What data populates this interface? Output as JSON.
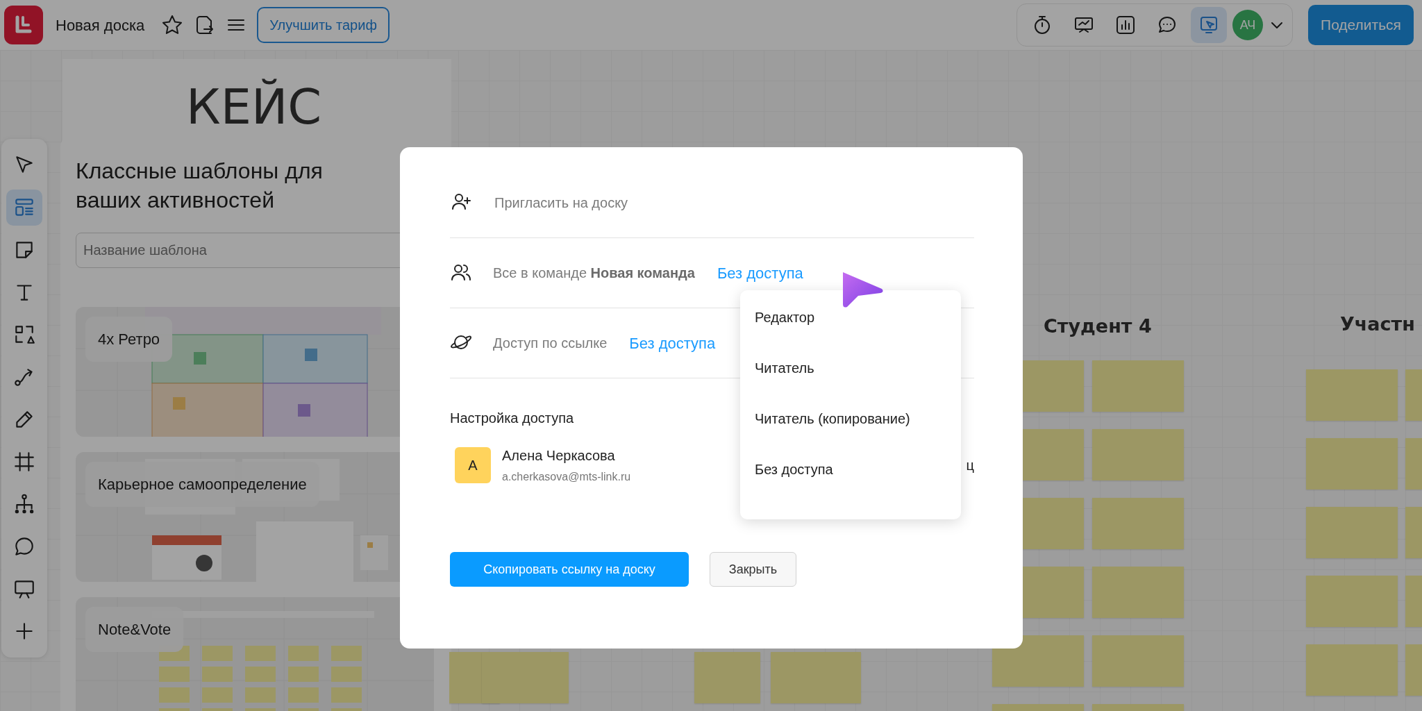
{
  "topbar": {
    "board_title": "Новая доска",
    "upgrade_button": "Улучшить тариф",
    "tools": [
      {
        "kind": "timer",
        "selected": false
      },
      {
        "kind": "presentation",
        "selected": false
      },
      {
        "kind": "chart",
        "selected": false
      },
      {
        "kind": "chat",
        "selected": false
      },
      {
        "kind": "follow",
        "selected": true
      }
    ],
    "avatar": {
      "initials": "АЧ"
    },
    "share_button": "Поделиться"
  },
  "toolrail": [
    {
      "kind": "select",
      "selected": false
    },
    {
      "kind": "templates",
      "selected": true
    },
    {
      "kind": "sticky",
      "selected": false
    },
    {
      "kind": "text",
      "selected": false
    },
    {
      "kind": "shapes",
      "selected": false
    },
    {
      "kind": "connector",
      "selected": false
    },
    {
      "kind": "pen",
      "selected": false
    },
    {
      "kind": "frame",
      "selected": false
    },
    {
      "kind": "mindmap",
      "selected": false
    },
    {
      "kind": "comment",
      "selected": false
    },
    {
      "kind": "screen",
      "selected": false
    },
    {
      "kind": "more",
      "selected": false
    }
  ],
  "board": {
    "frame_title": "КЕЙС",
    "column_headers": [
      "Студент 4",
      "Участн"
    ]
  },
  "templates_panel": {
    "title": "Классные шаблоны для ваших активностей",
    "search": {
      "placeholder": "Название шаблона"
    },
    "templates": [
      {
        "name": "4x Ретро",
        "kind": "picture"
      },
      {
        "name": "Карьерное самоопределение",
        "kind": "picture"
      },
      {
        "name": "Note&Vote",
        "kind": "picture"
      }
    ]
  },
  "share_dialog": {
    "invite": {
      "placeholder": "Пригласить на доску"
    },
    "team_access": {
      "text": "Все в команде **Новая команда**",
      "access": "Без доступа"
    },
    "link_access": {
      "label": "Доступ по ссылке",
      "access": "Без доступа"
    },
    "access_settings_title": "Настройка доступа",
    "members": [
      {
        "initial": "А",
        "color": "#ffd35c",
        "name": "Алена Черкасова",
        "email": "a.cherkasova@mts-link.ru",
        "role": "ц"
      }
    ],
    "access_menu": [
      "Редактор",
      "Читатель",
      "Читатель (копирование)",
      "Без доступа"
    ],
    "copy_button": "Скопировать ссылку на доску",
    "close_button": "Закрыть"
  }
}
